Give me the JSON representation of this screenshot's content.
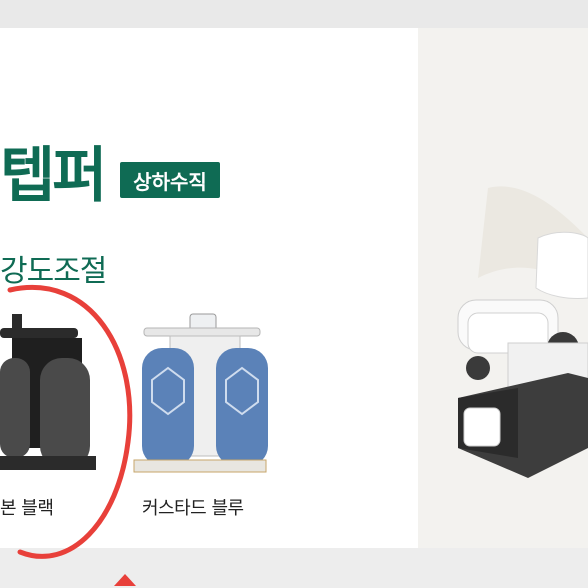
{
  "product": {
    "title": "텝퍼",
    "badge": "상하수직",
    "subtitle": "강도조절"
  },
  "options": [
    {
      "label": "본 블랙"
    },
    {
      "label": "커스타드 블루"
    }
  ],
  "colors": {
    "brand_green": "#0f6b54",
    "annotation_red": "#e8403a",
    "stepper_blue": "#5b82b8",
    "stepper_black": "#2b2b2b"
  }
}
